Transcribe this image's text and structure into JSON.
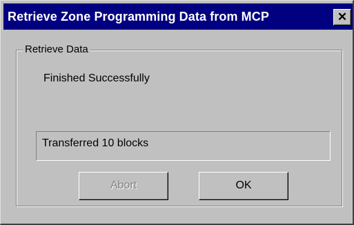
{
  "window": {
    "title": "Retrieve Zone Programming Data from MCP",
    "close_glyph": "✕"
  },
  "group": {
    "label": "Retrieve Data",
    "status": "Finished Successfully",
    "progress_text": "Transferred 10 blocks"
  },
  "buttons": {
    "abort_label": "Abort",
    "abort_enabled": false,
    "ok_label": "OK"
  },
  "colors": {
    "titlebar": "#000080",
    "face": "#c0c0c0"
  }
}
